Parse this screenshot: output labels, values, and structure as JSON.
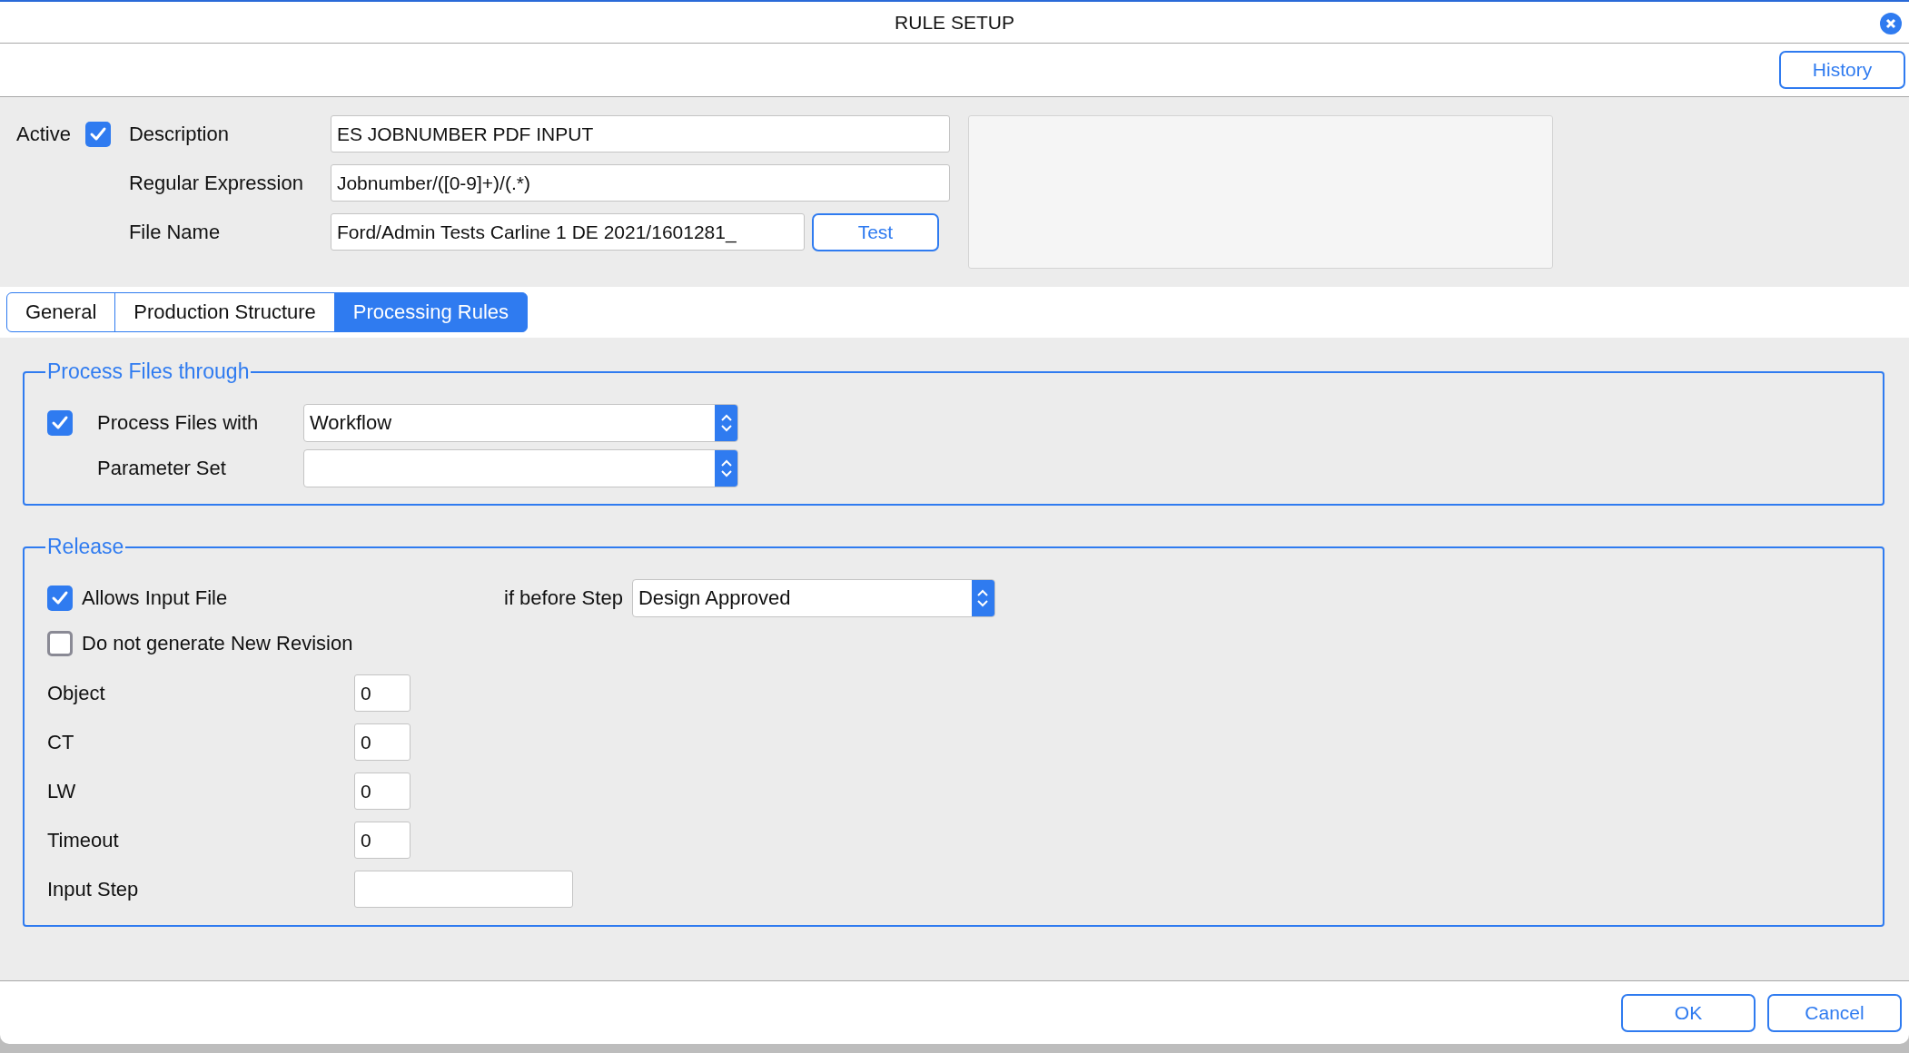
{
  "window": {
    "title": "RULE SETUP"
  },
  "toolbar": {
    "history_button": "History"
  },
  "header": {
    "active": {
      "label": "Active",
      "checked": true
    },
    "fields": [
      {
        "label": "Description",
        "value": "ES JOBNUMBER PDF INPUT"
      },
      {
        "label": "Regular Expression",
        "value": "Jobnumber/([0-9]+)/(.*)"
      },
      {
        "label": "File Name",
        "value": "Ford/Admin Tests Carline 1 DE 2021/1601281_"
      }
    ],
    "test_button": "Test"
  },
  "tabs": [
    {
      "label": "General",
      "selected": false
    },
    {
      "label": "Production Structure",
      "selected": false
    },
    {
      "label": "Processing Rules",
      "selected": true
    }
  ],
  "process_files": {
    "legend": "Process Files through",
    "process_with": {
      "label": "Process Files with",
      "checked": true,
      "value": "Workflow"
    },
    "parameter_set": {
      "label": "Parameter Set"
    }
  },
  "release": {
    "legend": "Release",
    "allows_input_file": {
      "label": "Allows Input File",
      "checked": true
    },
    "if_before_step": {
      "label": "if before Step",
      "value": "Design Approved"
    },
    "no_new_revision": {
      "label": "Do not generate New Revision",
      "checked": false
    },
    "fields": [
      {
        "label": "Object",
        "value": "0",
        "kind": "number"
      },
      {
        "label": "CT",
        "value": "0",
        "kind": "number"
      },
      {
        "label": "LW",
        "value": "0",
        "kind": "number"
      },
      {
        "label": "Timeout",
        "value": "0",
        "kind": "number"
      },
      {
        "label": "Input Step",
        "kind": "text"
      }
    ]
  },
  "footer": {
    "buttons": [
      "OK",
      "Cancel"
    ]
  }
}
